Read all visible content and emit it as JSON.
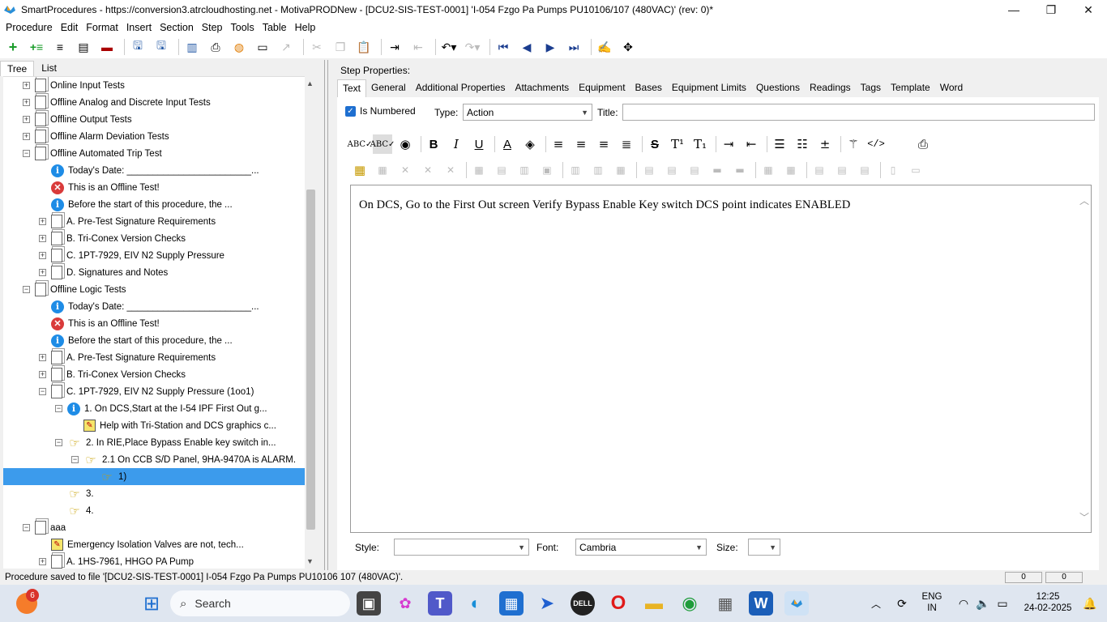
{
  "window": {
    "title": "SmartProcedures - https://conversion3.atrcloudhosting.net - MotivaPRODNew - [DCU2-SIS-TEST-0001] 'I-054 Fzgo Pa Pumps PU10106/107 (480VAC)' (rev: 0)*",
    "minimize": "—",
    "maximize": "❐",
    "close": "✕"
  },
  "menu": [
    "Procedure",
    "Edit",
    "Format",
    "Insert",
    "Section",
    "Step",
    "Tools",
    "Table",
    "Help"
  ],
  "left_tabs": [
    "Tree",
    "List"
  ],
  "tree": [
    {
      "indent": 0,
      "exp": "+",
      "icon": "doc",
      "label": "Online Input Tests"
    },
    {
      "indent": 0,
      "exp": "+",
      "icon": "doc",
      "label": "Offline Analog and Discrete Input Tests"
    },
    {
      "indent": 0,
      "exp": "+",
      "icon": "doc",
      "label": "Offline Output Tests"
    },
    {
      "indent": 0,
      "exp": "+",
      "icon": "doc",
      "label": "Offline Alarm Deviation Tests"
    },
    {
      "indent": 0,
      "exp": "−",
      "icon": "doc",
      "label": "Offline Automated Trip Test"
    },
    {
      "indent": 1,
      "exp": "",
      "icon": "info",
      "label": "Today's Date: ________________________..."
    },
    {
      "indent": 1,
      "exp": "",
      "icon": "err",
      "label": "This is an Offline Test!"
    },
    {
      "indent": 1,
      "exp": "",
      "icon": "info",
      "label": "Before the start of this procedure, the ..."
    },
    {
      "indent": 1,
      "exp": "+",
      "icon": "doc",
      "label": "A. Pre-Test Signature Requirements"
    },
    {
      "indent": 1,
      "exp": "+",
      "icon": "doc",
      "label": "B. Tri-Conex Version Checks"
    },
    {
      "indent": 1,
      "exp": "+",
      "icon": "doc",
      "label": "C. 1PT-7929, EIV N2 Supply Pressure"
    },
    {
      "indent": 1,
      "exp": "+",
      "icon": "doc",
      "label": "D. Signatures and Notes"
    },
    {
      "indent": 0,
      "exp": "−",
      "icon": "doc",
      "label": "Offline Logic Tests"
    },
    {
      "indent": 1,
      "exp": "",
      "icon": "info",
      "label": "Today's Date: ________________________..."
    },
    {
      "indent": 1,
      "exp": "",
      "icon": "err",
      "label": "This is an Offline Test!"
    },
    {
      "indent": 1,
      "exp": "",
      "icon": "info",
      "label": "Before the start of this procedure, the ..."
    },
    {
      "indent": 1,
      "exp": "+",
      "icon": "doc",
      "label": "A. Pre-Test Signature Requirements"
    },
    {
      "indent": 1,
      "exp": "+",
      "icon": "doc",
      "label": "B. Tri-Conex Version Checks"
    },
    {
      "indent": 1,
      "exp": "−",
      "icon": "doc",
      "label": "C. 1PT-7929, EIV N2 Supply Pressure (1oo1)"
    },
    {
      "indent": 2,
      "exp": "−",
      "icon": "info",
      "label": "1. On DCS,Start at the I-54 IPF First Out g..."
    },
    {
      "indent": 3,
      "exp": "",
      "icon": "help",
      "label": "Help with Tri-Station and DCS graphics c..."
    },
    {
      "indent": 2,
      "exp": "−",
      "icon": "hand",
      "label": "2. In RIE,Place Bypass Enable key switch in..."
    },
    {
      "indent": 3,
      "exp": "−",
      "icon": "hand",
      "label": "2.1 On CCB S/D Panel, 9HA-9470A is ALARM."
    },
    {
      "indent": 4,
      "exp": "",
      "icon": "hand",
      "label": "1)",
      "selected": true
    },
    {
      "indent": 2,
      "exp": "",
      "icon": "hand",
      "label": "3."
    },
    {
      "indent": 2,
      "exp": "",
      "icon": "hand",
      "label": "4."
    },
    {
      "indent": 0,
      "exp": "−",
      "icon": "doc",
      "label": "aaa"
    },
    {
      "indent": 1,
      "exp": "",
      "icon": "help",
      "label": "Emergency Isolation Valves are not, tech..."
    },
    {
      "indent": 1,
      "exp": "+",
      "icon": "doc",
      "label": "A. 1HS-7961, HHGO PA Pump"
    }
  ],
  "step_props": {
    "label": "Step Properties:",
    "tabs": [
      "Text",
      "General",
      "Additional Properties",
      "Attachments",
      "Equipment",
      "Bases",
      "Equipment Limits",
      "Questions",
      "Readings",
      "Tags",
      "Template",
      "Word"
    ],
    "is_numbered_label": "Is Numbered",
    "type_label": "Type:",
    "type_value": "Action",
    "title_label": "Title:",
    "title_value": "",
    "editor_text": "On DCS, Go to the First Out screen Verify Bypass Enable Key switch DCS point indicates ENABLED",
    "style_label": "Style:",
    "style_value": "",
    "font_label": "Font:",
    "font_value": "Cambria",
    "size_label": "Size:",
    "size_value": ""
  },
  "status": {
    "text": "Procedure saved to file '[DCU2-SIS-TEST-0001] I-054 Fzgo Pa Pumps PU10106 107 (480VAC)'.",
    "box1": "0",
    "box2": "0"
  },
  "taskbar": {
    "search_placeholder": "Search",
    "badge": "6",
    "lang_line1": "ENG",
    "lang_line2": "IN",
    "time": "12:25",
    "date": "24-02-2025"
  },
  "colors": {
    "selection": "#3c9bec",
    "accent": "#1e6fd0"
  }
}
